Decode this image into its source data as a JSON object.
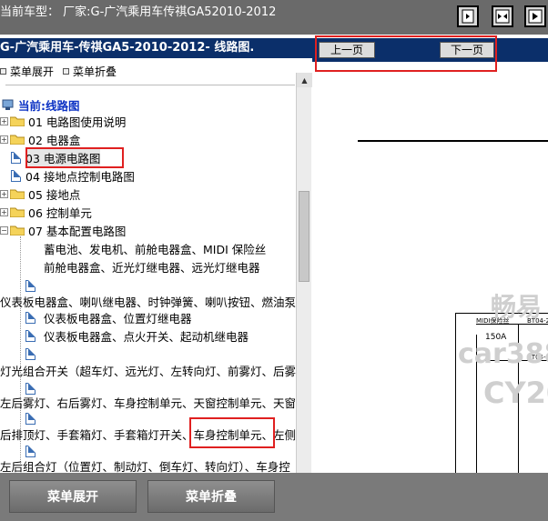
{
  "topbar": {
    "title": "当前车型： 厂家:G-广汽乘用车传祺GA52010-2012"
  },
  "left": {
    "header": "G-广汽乘用车-传祺GA5-2010-2012- 线路图.",
    "expand_label": "菜单展开",
    "collapse_label": "菜单折叠",
    "root_label": "当前:线路图",
    "items": [
      "01 电路图使用说明",
      "02 电器盒",
      "03 电源电路图",
      "04 接地点控制电路图",
      "05 接地点",
      "06 控制单元",
      "07 基本配置电路图"
    ],
    "sub_items": [
      "蓄电池、发电机、前舱电器盒、MIDI 保险丝",
      "前舱电器盒、近光灯继电器、远光灯继电器",
      "仪表板电器盒、喇叭继电器、时钟弹簧、喇叭按钮、燃油泵",
      "仪表板电器盒、位置灯继电器",
      "仪表板电器盒、点火开关、起动机继电器",
      "灯光组合开关（超车灯、远光灯、左转向灯、前雾灯、后雾",
      "左后雾灯、右后雾灯、车身控制单元、天窗控制单元、天窗",
      "后排顶灯、手套箱灯、手套箱灯开关、车身控制单元、左侧",
      "左后组合灯（位置灯、制动灯、倒车灯、转向灯）、车身控"
    ]
  },
  "right": {
    "prev_label": "上一页",
    "next_label": "下一页",
    "diagram_labels": {
      "midi": "MIDI保险丝",
      "fuse": "150A",
      "bt1": "BT04-2",
      "bt2": "BT04-1"
    },
    "watermarks": [
      "畅易",
      "car388.",
      "CY20"
    ]
  },
  "bottom": {
    "expand_button": "菜单展开",
    "collapse_button": "菜单折叠"
  },
  "colors": {
    "header_bg": "#0b2f6a",
    "highlight_box": "#e02020",
    "root_label": "#0d33c4"
  }
}
